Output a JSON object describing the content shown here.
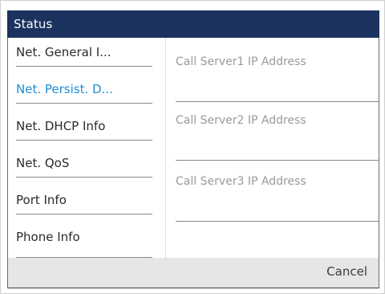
{
  "header": {
    "title": "Status"
  },
  "menu": {
    "items": [
      {
        "label": "Net. General I...",
        "selected": false
      },
      {
        "label": "Net. Persist. D...",
        "selected": true
      },
      {
        "label": "Net. DHCP Info",
        "selected": false
      },
      {
        "label": "Net. QoS",
        "selected": false
      },
      {
        "label": "Port Info",
        "selected": false
      },
      {
        "label": "Phone Info",
        "selected": false
      }
    ]
  },
  "fields": [
    {
      "label": "Call Server1 IP Address",
      "value": ""
    },
    {
      "label": "Call Server2 IP Address",
      "value": ""
    },
    {
      "label": "Call Server3 IP Address",
      "value": ""
    }
  ],
  "footer": {
    "cancel_label": "Cancel"
  },
  "colors": {
    "header_bg": "#1c3360",
    "selected_text": "#1d8fd6",
    "footer_bg": "#e6e6e6"
  }
}
